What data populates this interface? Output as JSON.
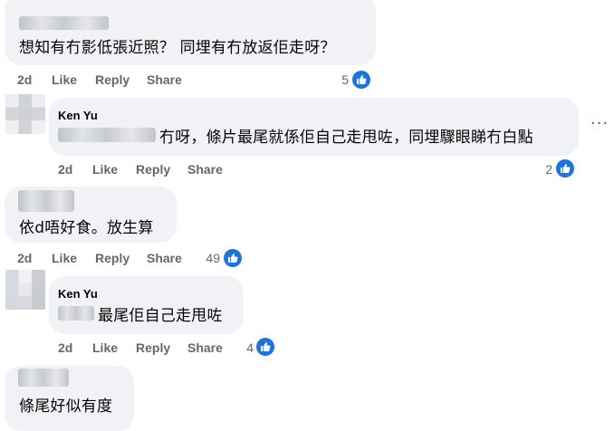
{
  "comments": [
    {
      "text": "想知有冇影低張近照？ 同埋有冇放返佢走呀？",
      "actions": {
        "time": "2d",
        "like": "Like",
        "reply": "Share",
        "reply_label": "Reply"
      },
      "reactions": "5"
    },
    {
      "author": "Ken Yu",
      "text": "冇呀，條片最尾就係佢自己走甩咗，同埋驟眼睇冇白點",
      "actions": {
        "time": "2d",
        "like": "Like",
        "reply_label": "Reply",
        "share": "Share"
      },
      "reactions": "2"
    },
    {
      "text": "依d唔好食。放生算",
      "actions": {
        "time": "2d",
        "like": "Like",
        "reply_label": "Reply",
        "share": "Share"
      },
      "reactions": "49"
    },
    {
      "author": "Ken Yu",
      "text": "最尾佢自己走甩咗",
      "actions": {
        "time": "2d",
        "like": "Like",
        "reply_label": "Reply",
        "share": "Share"
      },
      "reactions": "4"
    },
    {
      "text": "條尾好似有度"
    }
  ],
  "more_glyph": "···",
  "colors": {
    "bubble": "#f0f2f5",
    "like_blue": "#1b74e4",
    "meta_gray": "#65676b"
  },
  "icons": [
    "like-icon",
    "more-options-icon"
  ]
}
